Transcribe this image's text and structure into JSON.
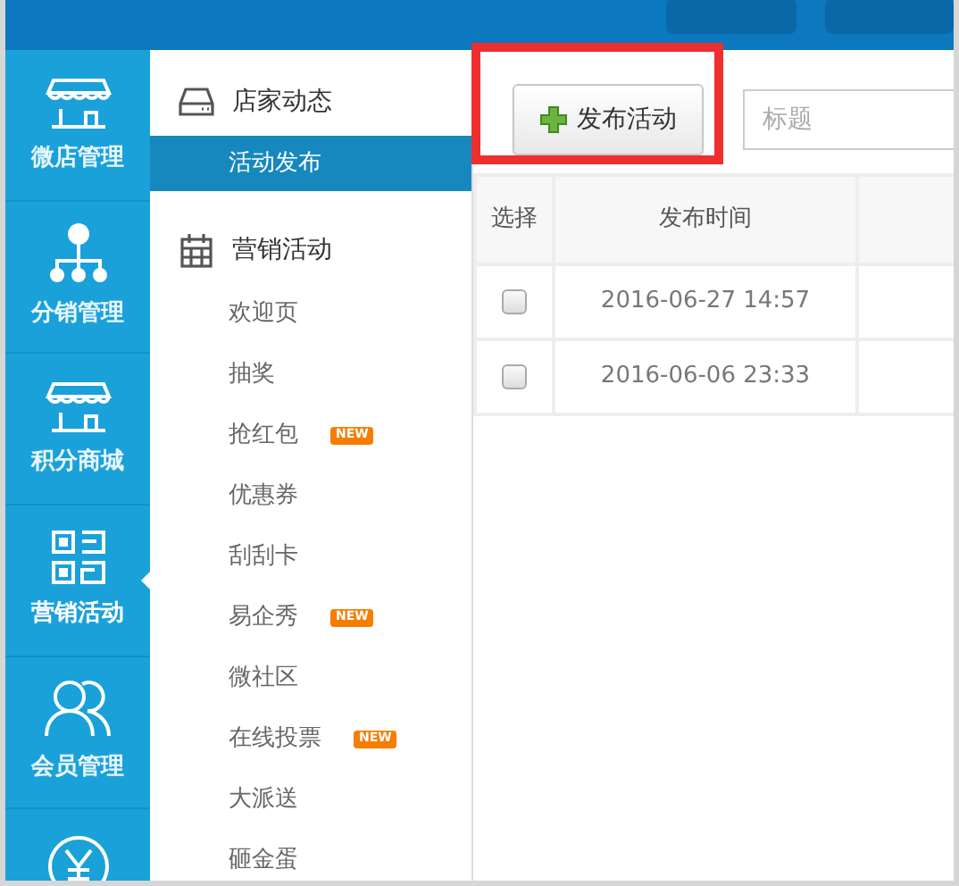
{
  "main_nav": [
    {
      "label": "微店管理",
      "selected": false
    },
    {
      "label": "分销管理",
      "selected": false
    },
    {
      "label": "积分商城",
      "selected": false
    },
    {
      "label": "营销活动",
      "selected": true
    },
    {
      "label": "会员管理",
      "selected": false
    },
    {
      "selected": false
    }
  ],
  "sub_nav": [
    {
      "title": "店家动态",
      "items": [
        {
          "label": "活动发布",
          "selected": true
        }
      ]
    },
    {
      "title": "营销活动",
      "items": [
        {
          "label": "欢迎页",
          "selected": false
        },
        {
          "label": "抽奖",
          "selected": false
        },
        {
          "label": "抢红包",
          "selected": false,
          "badge": "NEW"
        },
        {
          "label": "优惠券",
          "selected": false
        },
        {
          "label": "刮刮卡",
          "selected": false
        },
        {
          "label": "易企秀",
          "selected": false,
          "badge": "NEW"
        },
        {
          "label": "微社区",
          "selected": false
        },
        {
          "label": "在线投票",
          "selected": false,
          "badge": "NEW"
        },
        {
          "label": "大派送",
          "selected": false
        },
        {
          "label": "砸金蛋",
          "selected": false
        }
      ]
    }
  ],
  "toolbar": {
    "publish_button": "发布活动",
    "search": {
      "placeholder": "标题"
    }
  },
  "table": {
    "columns": [
      "选择",
      "发布时间"
    ],
    "rows": [
      {
        "checked": false,
        "time": "2016-06-27 14:57"
      },
      {
        "checked": false,
        "time": "2016-06-06 23:33"
      }
    ]
  }
}
